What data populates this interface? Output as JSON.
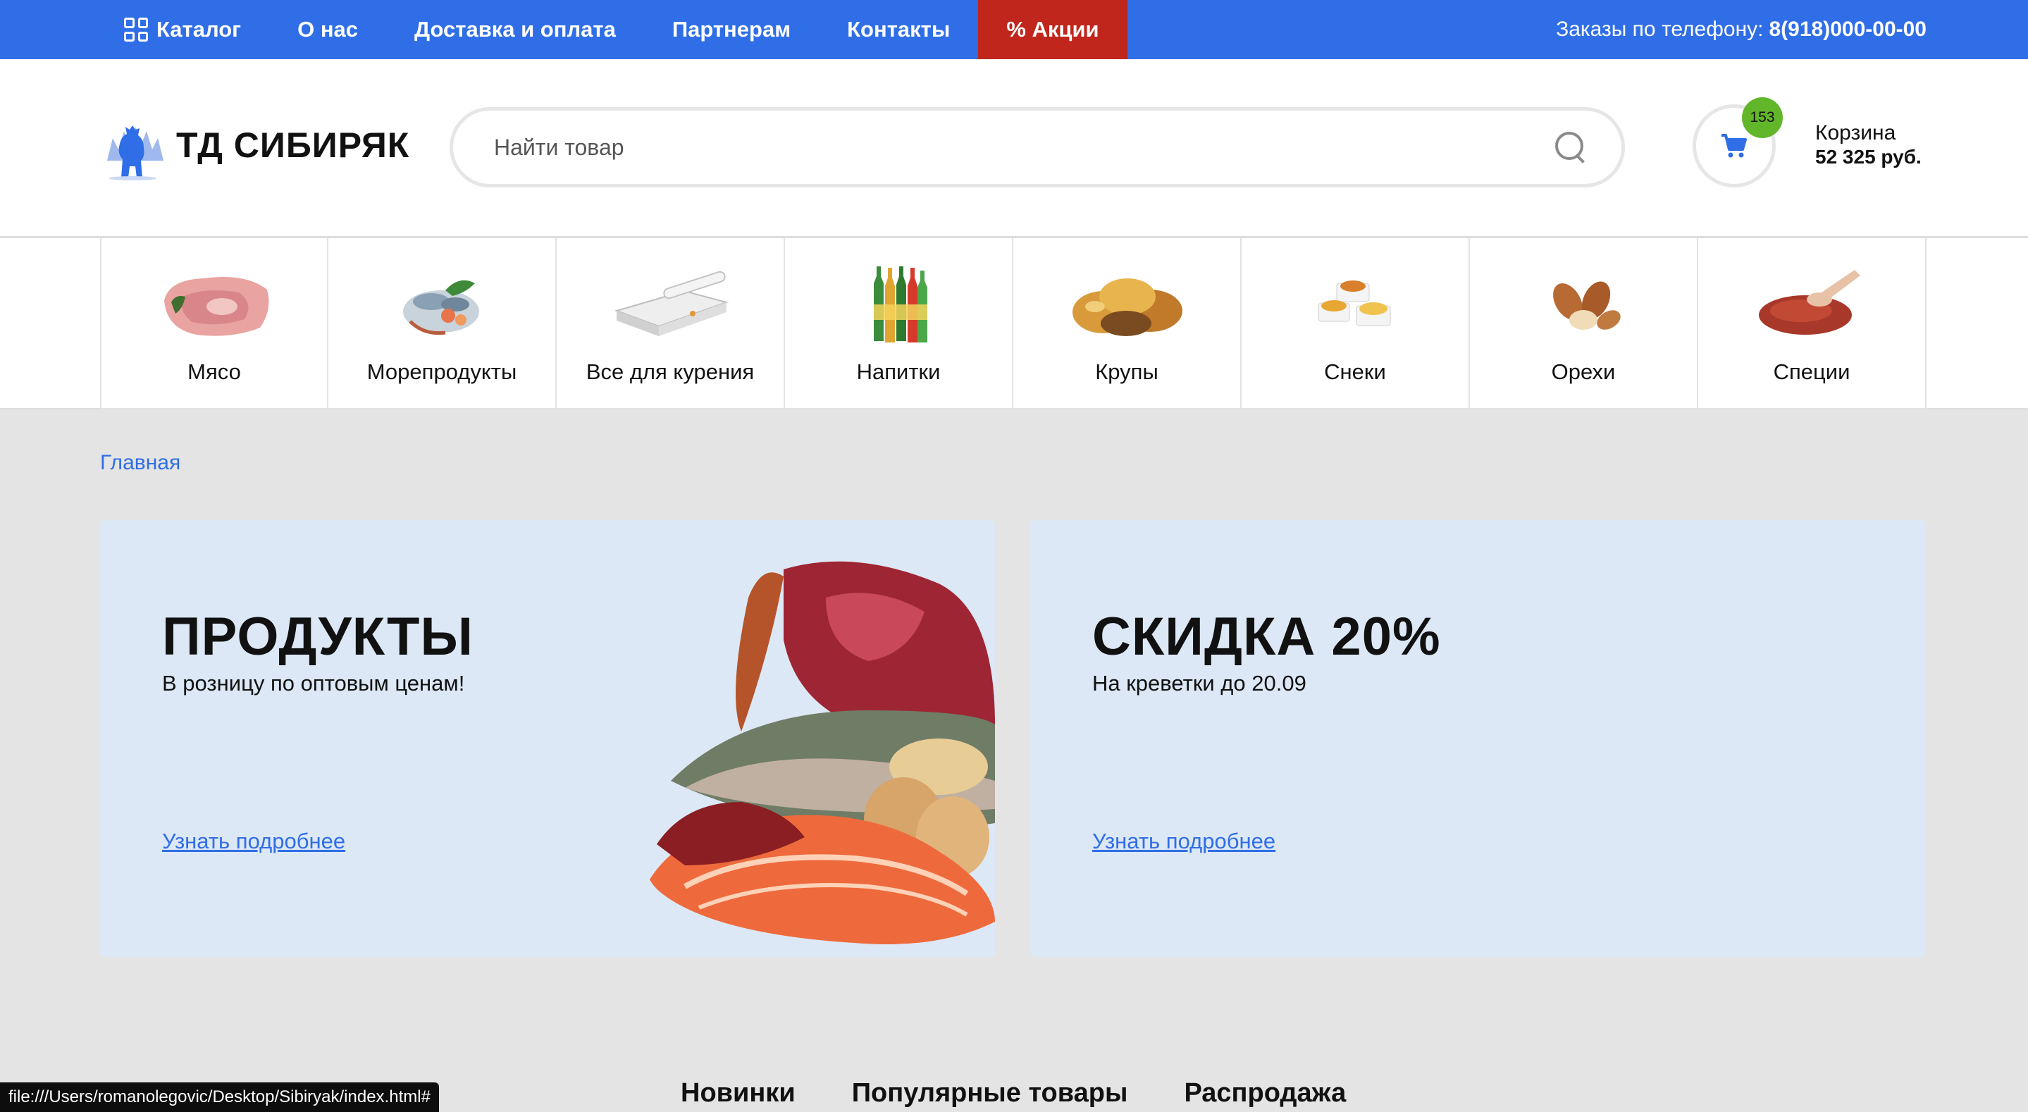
{
  "topnav": {
    "items": [
      {
        "label": "Каталог",
        "icon": "grid-icon"
      },
      {
        "label": "О нас"
      },
      {
        "label": "Доставка и оплата"
      },
      {
        "label": "Партнерам"
      },
      {
        "label": "Контакты"
      },
      {
        "label": "% Акции",
        "highlight": true
      }
    ],
    "phone_label": "Заказы по телефону:",
    "phone_number": "8(918)000-00-00"
  },
  "header": {
    "logo_text": "ТД СИБИРЯК",
    "search_placeholder": "Найти товар",
    "cart": {
      "count": "153",
      "label": "Корзина",
      "total": "52 325 руб."
    }
  },
  "categories": [
    {
      "label": "Мясо",
      "icon": "meat-icon"
    },
    {
      "label": "Морепродукты",
      "icon": "seafood-icon"
    },
    {
      "label": "Все для курения",
      "icon": "smoking-icon"
    },
    {
      "label": "Напитки",
      "icon": "drinks-icon"
    },
    {
      "label": "Крупы",
      "icon": "grains-icon"
    },
    {
      "label": "Снеки",
      "icon": "snacks-icon"
    },
    {
      "label": "Орехи",
      "icon": "nuts-icon"
    },
    {
      "label": "Специи",
      "icon": "spices-icon"
    }
  ],
  "breadcrumb": "Главная",
  "banners": [
    {
      "title": "ПРОДУКТЫ",
      "subtitle": "В розницу по оптовым ценам!",
      "link": "Узнать подробнее"
    },
    {
      "title": "СКИДКА 20%",
      "subtitle": "На креветки до 20.09",
      "link": "Узнать подробнее"
    }
  ],
  "tabs": [
    "Новинки",
    "Популярные товары",
    "Распродажа"
  ],
  "status_url": "file:///Users/romanolegovic/Desktop/Sibiryak/index.html#",
  "colors": {
    "brand_blue": "#2f6ee6",
    "promo_red": "#c0261b",
    "badge_green": "#62b62a",
    "banner_bg": "#dde8f6"
  }
}
